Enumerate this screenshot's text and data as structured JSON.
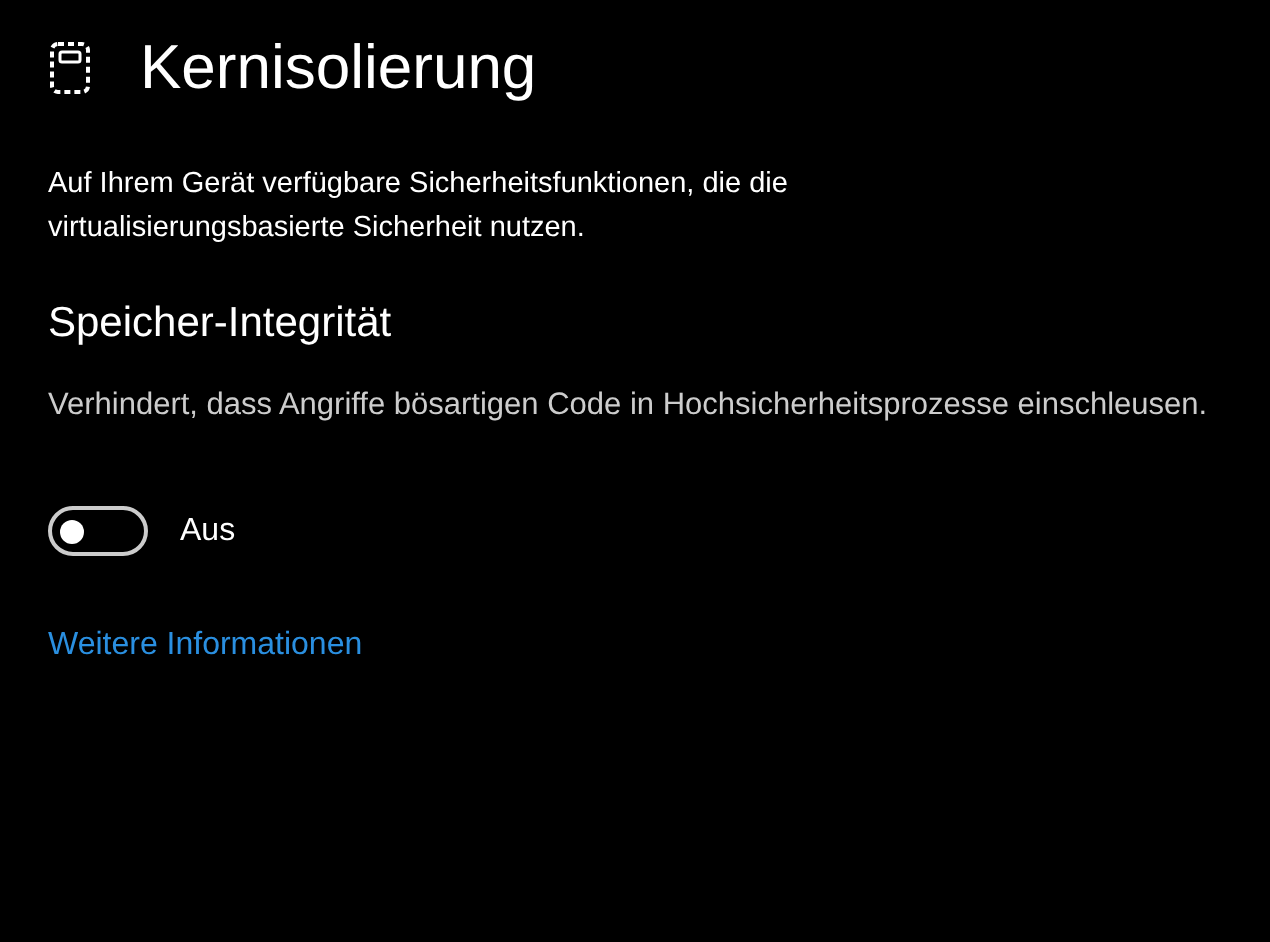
{
  "header": {
    "title": "Kernisolierung"
  },
  "description": "Auf Ihrem Gerät verfügbare Sicherheitsfunktionen, die die virtualisierungsbasierte Sicherheit nutzen.",
  "section": {
    "title": "Speicher-Integrität",
    "description": "Verhindert, dass Angriffe bösartigen Code in Hochsicherheitsprozesse einschleusen.",
    "toggle": {
      "on": false,
      "label": "Aus"
    }
  },
  "link": "Weitere Informationen"
}
